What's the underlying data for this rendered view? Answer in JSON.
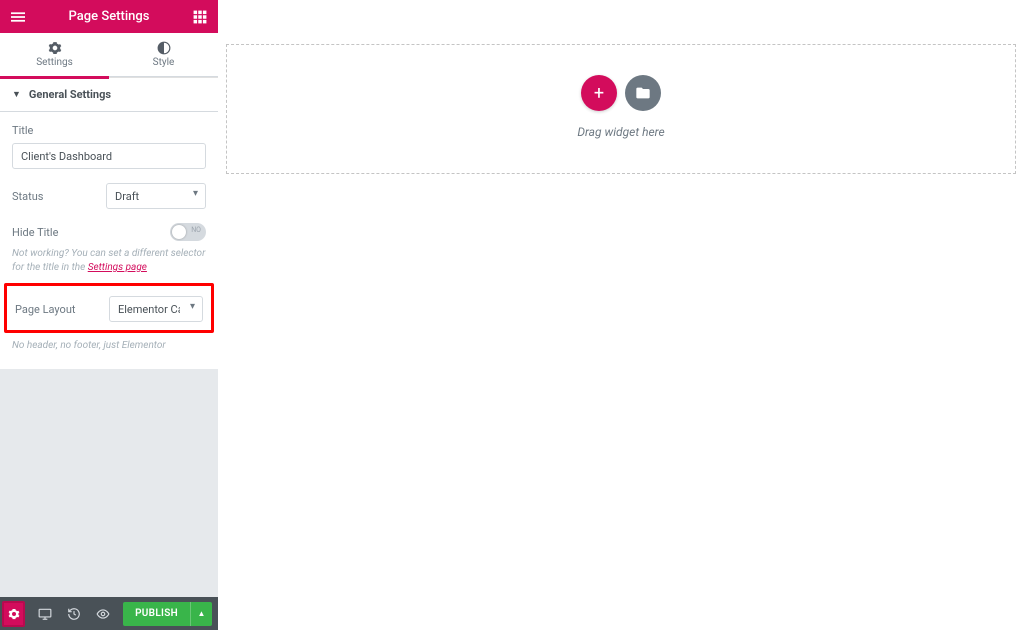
{
  "header": {
    "title": "Page Settings"
  },
  "tabs": {
    "settings": "Settings",
    "style": "Style"
  },
  "section": {
    "general": "General Settings"
  },
  "fields": {
    "title_label": "Title",
    "title_value": "Client's Dashboard",
    "status_label": "Status",
    "status_value": "Draft",
    "hide_title_label": "Hide Title",
    "hide_title_toggle_text": "NO",
    "hint_not_working_prefix": "Not working? You can set a different selector for the title in the ",
    "hint_settings_link": "Settings page",
    "layout_label": "Page Layout",
    "layout_value": "Elementor Canvas",
    "layout_hint": "No header, no footer, just Elementor"
  },
  "footer": {
    "publish": "PUBLISH"
  },
  "canvas": {
    "drag_text": "Drag widget here"
  }
}
